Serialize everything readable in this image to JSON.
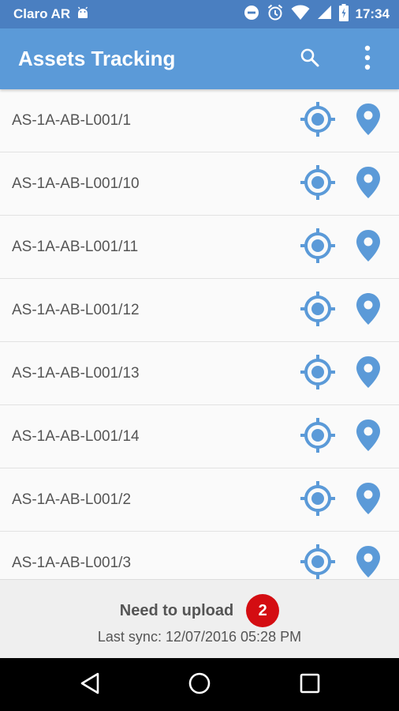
{
  "status_bar": {
    "carrier": "Claro AR",
    "time": "17:34",
    "icons": [
      "android-icon",
      "do-not-disturb-icon",
      "alarm-icon",
      "wifi-icon",
      "signal-icon",
      "battery-charging-icon"
    ]
  },
  "app_bar": {
    "title": "Assets Tracking",
    "icons": [
      "search-icon",
      "more-vert-icon"
    ],
    "color": "#5b9ad8"
  },
  "assets": [
    {
      "label": "AS-1A-AB-L001/1"
    },
    {
      "label": "AS-1A-AB-L001/10"
    },
    {
      "label": "AS-1A-AB-L001/11"
    },
    {
      "label": "AS-1A-AB-L001/12"
    },
    {
      "label": "AS-1A-AB-L001/13"
    },
    {
      "label": "AS-1A-AB-L001/14"
    },
    {
      "label": "AS-1A-AB-L001/2"
    },
    {
      "label": "AS-1A-AB-L001/3"
    }
  ],
  "row_icons": [
    "gps-target-icon",
    "map-pin-icon"
  ],
  "accent_color": "#5b9ad8",
  "footer": {
    "upload_label": "Need to upload",
    "upload_count": "2",
    "last_sync": "Last sync: 12/07/2016 05:28 PM",
    "badge_color": "#d40d12"
  },
  "nav_bar": {
    "icons": [
      "back-icon",
      "home-icon",
      "recents-icon"
    ]
  }
}
